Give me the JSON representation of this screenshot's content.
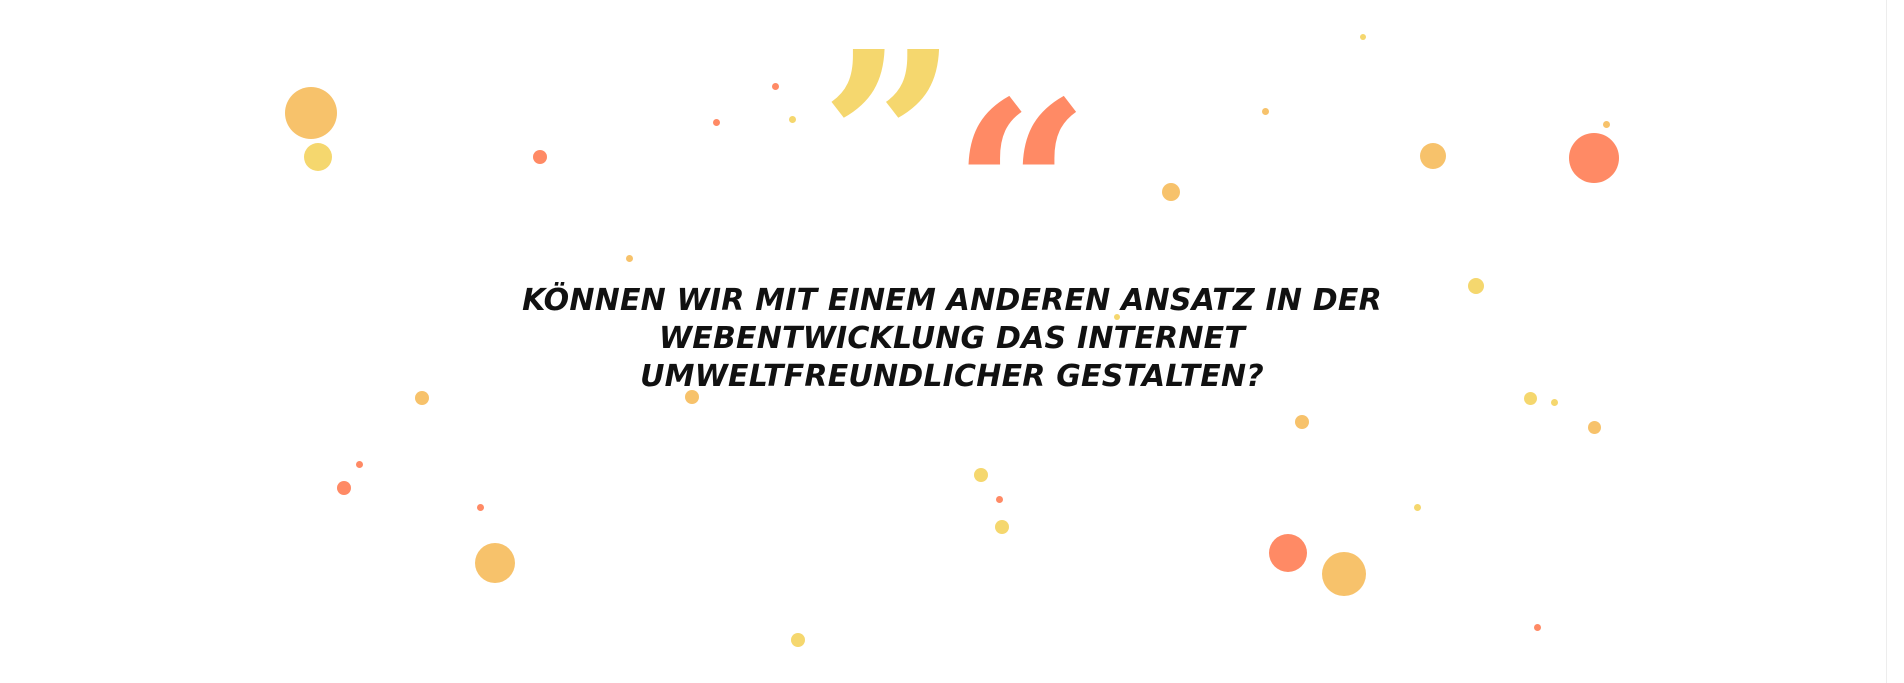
{
  "headline": {
    "line1": "KÖNNEN WIR MIT EINEM ANDEREN ANSATZ IN DER",
    "line2": "WEBENTWICKLUNG DAS INTERNET",
    "line3": "UMWELTFREUNDLICHER GESTALTEN?"
  },
  "quote_marks": {
    "close": "”",
    "open": "“"
  },
  "colors": {
    "background": "#ffffff",
    "text": "#111111",
    "yellow": "#f5d76e",
    "amber": "#f7c26b",
    "coral": "#ff8a65"
  },
  "icons": [
    "quote-close-icon",
    "quote-open-icon",
    "confetti-dot-icon"
  ]
}
